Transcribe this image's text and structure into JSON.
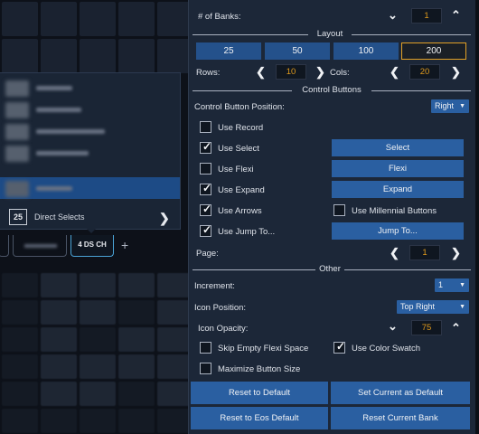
{
  "left": {
    "popup": {
      "direct_selects_badge": "25",
      "direct_selects_label": "Direct Selects",
      "chevron_icon": "chevron-right-icon"
    },
    "tabs": {
      "active_label": "4 DS CH",
      "add_icon": "plus-icon"
    }
  },
  "settings": {
    "banks": {
      "label": "# of Banks:",
      "value": "1"
    },
    "layout": {
      "title": "Layout",
      "options": [
        "25",
        "50",
        "100",
        "200"
      ],
      "selected": "200",
      "rows_label": "Rows:",
      "rows_value": "10",
      "cols_label": "Cols:",
      "cols_value": "20"
    },
    "control_buttons": {
      "title": "Control Buttons",
      "position_label": "Control Button Position:",
      "position_value": "Right",
      "use_record": {
        "label": "Use Record",
        "checked": false
      },
      "use_select": {
        "label": "Use Select",
        "checked": true,
        "button": "Select"
      },
      "use_flexi": {
        "label": "Use Flexi",
        "checked": false,
        "button": "Flexi"
      },
      "use_expand": {
        "label": "Use Expand",
        "checked": true,
        "button": "Expand"
      },
      "use_arrows": {
        "label": "Use Arrows",
        "checked": true
      },
      "use_millennial": {
        "label": "Use Millennial Buttons",
        "checked": false
      },
      "use_jump_to": {
        "label": "Use Jump To...",
        "checked": true,
        "button": "Jump To..."
      },
      "page_label": "Page:",
      "page_value": "1"
    },
    "other": {
      "title": "Other",
      "increment_label": "Increment:",
      "increment_value": "1",
      "icon_position_label": "Icon Position:",
      "icon_position_value": "Top Right",
      "icon_opacity_label": "Icon Opacity:",
      "icon_opacity_value": "75",
      "skip_empty": {
        "label": "Skip Empty Flexi Space",
        "checked": false
      },
      "use_color_swatch": {
        "label": "Use Color Swatch",
        "checked": true
      },
      "maximize": {
        "label": "Maximize Button Size",
        "checked": false
      }
    },
    "buttons": {
      "reset_default": "Reset to Default",
      "set_current_default": "Set Current as Default",
      "reset_eos_default": "Reset to Eos Default",
      "reset_current_bank": "Reset Current Bank"
    }
  },
  "colors": {
    "accent_orange": "#e2a025",
    "button_blue": "#2a5fa1",
    "panel_bg": "#1c2738",
    "selected_item": "#1d4b86"
  }
}
